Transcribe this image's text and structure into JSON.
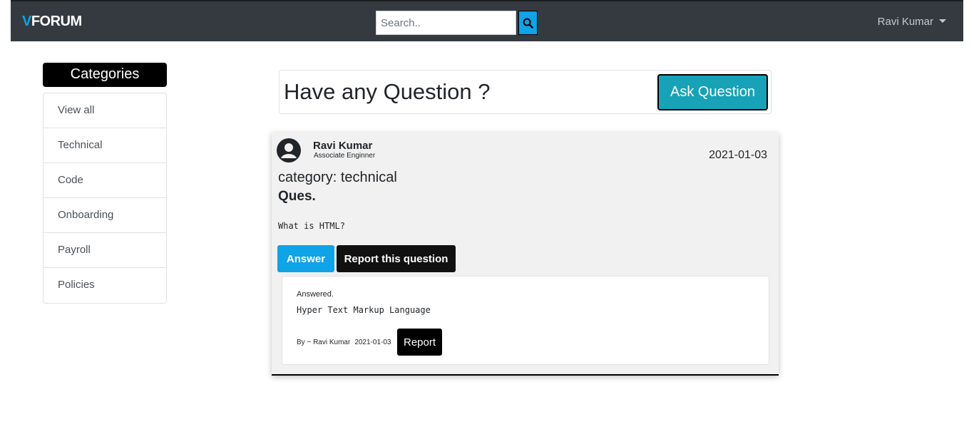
{
  "navbar": {
    "brand_v": "V",
    "brand_rest": "FORUM",
    "search": {
      "placeholder": "Search..",
      "value": ""
    },
    "user_name": "Ravi Kumar",
    "colors": {
      "background": "#343a40",
      "accent": "#0fa3e8"
    }
  },
  "sidebar": {
    "title": "Categories",
    "items": [
      {
        "label": "View all"
      },
      {
        "label": "Technical"
      },
      {
        "label": "Code"
      },
      {
        "label": "Onboarding"
      },
      {
        "label": "Payroll"
      },
      {
        "label": "Policies"
      }
    ]
  },
  "ask": {
    "title": "Have any Question ?",
    "button_label": "Ask Question"
  },
  "question": {
    "author": "Ravi Kumar",
    "role": "Associate Enginner",
    "date": "2021-01-03",
    "category": "category: technical",
    "label": "Ques.",
    "text": "What is HTML?",
    "answer_button": "Answer",
    "report_button": "Report this question",
    "answer": {
      "status": "Answered.",
      "text": "Hyper Text Markup Language",
      "by": "By ~ Ravi Kumar",
      "date": "2021-01-03",
      "report_button": "Report"
    }
  }
}
